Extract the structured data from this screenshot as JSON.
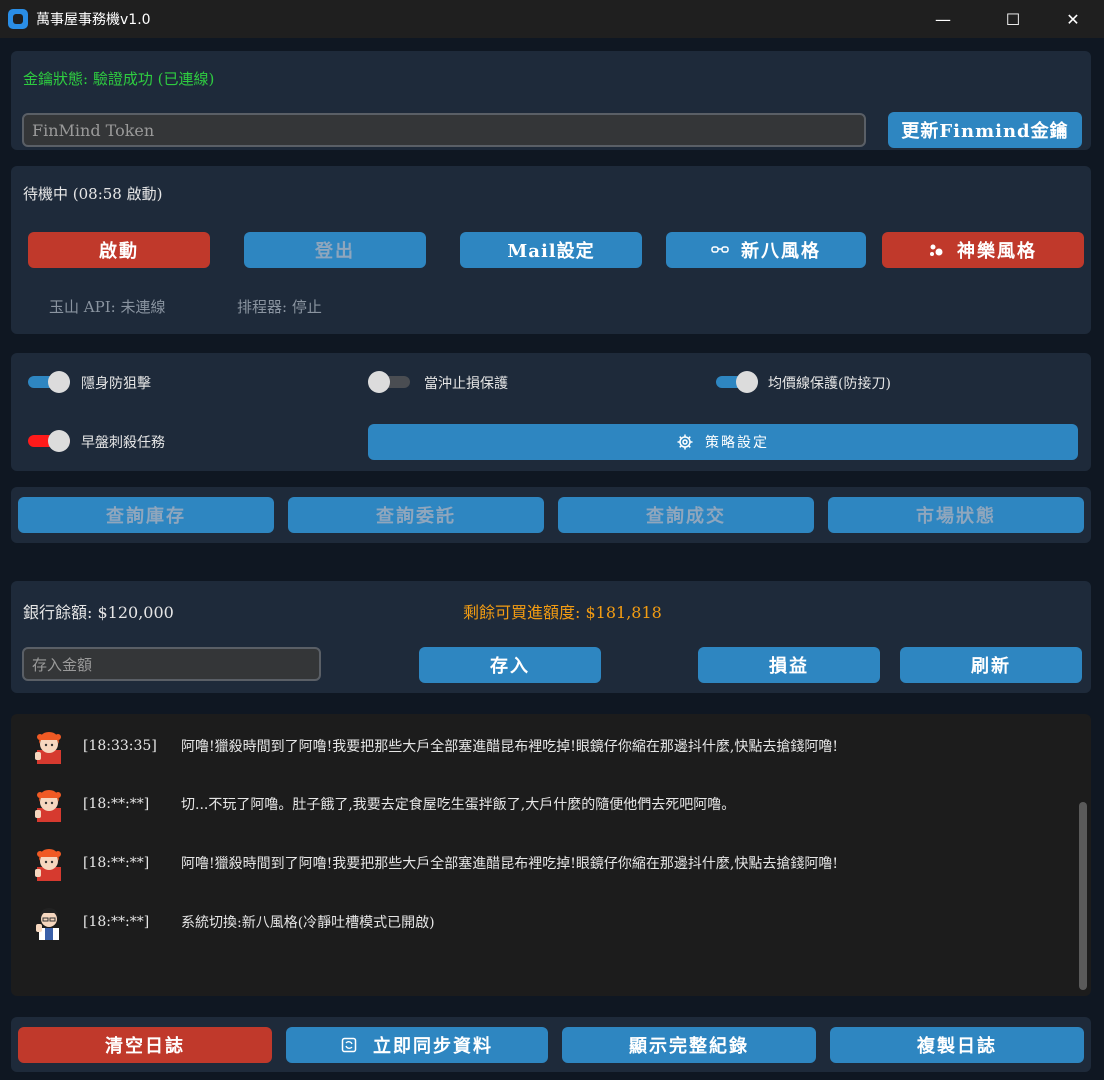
{
  "window": {
    "title": "萬事屋事務機v1.0",
    "minimize_glyph": "—",
    "maximize_glyph": "☐",
    "close_glyph": "✕"
  },
  "key_panel": {
    "status": "金鑰狀態: 驗證成功 (已連線)",
    "token_placeholder": "FinMind Token",
    "update_button": "更新Finmind金鑰"
  },
  "control_panel": {
    "status": "待機中 (08:58 啟動)",
    "buttons": {
      "start": "啟動",
      "logout": "登出",
      "mail": "Mail設定",
      "shinpachi": "新八風格",
      "kagura": "神樂風格"
    },
    "shinpachi_icon": "glasses-icon",
    "kagura_icon": "paw-icon",
    "api_status": "玉山 API: 未連線",
    "scheduler_status": "排程器: 停止"
  },
  "options_panel": {
    "toggles": [
      {
        "label": "隱身防狙擊",
        "state": "on"
      },
      {
        "label": "當沖止損保護",
        "state": "off"
      },
      {
        "label": "均價線保護(防接刀)",
        "state": "on"
      },
      {
        "label": "早盤刺殺任務",
        "state": "on-red"
      }
    ],
    "strategy_button": "策略設定",
    "strategy_icon": "gear-icon",
    "colors": {
      "on": "#2e86c1",
      "off": "#4a4d52",
      "danger": "#ff1a1a"
    }
  },
  "query_panel": {
    "inventory": "查詢庫存",
    "orders": "查詢委託",
    "deals": "查詢成交",
    "market": "市場狀態"
  },
  "bank_panel": {
    "balance": "銀行餘額: $120,000",
    "remaining": "剩餘可買進額度: $181,818",
    "deposit_placeholder": "存入金額",
    "deposit_button": "存入",
    "pnl_button": "損益",
    "refresh_button": "刷新",
    "remaining_color": "#f39c12"
  },
  "log": {
    "entries": [
      {
        "avatar": "kagura-avatar",
        "time": "[18:33:35]",
        "message": "阿噜!獵殺時間到了阿噜!我要把那些大戶全部塞進醋昆布裡吃掉!眼鏡仔你縮在那邊抖什麼,快點去搶錢阿噜!"
      },
      {
        "avatar": "kagura-avatar",
        "time": "[18:**:**]",
        "message": "切...不玩了阿噜。肚子餓了,我要去定食屋吃生蛋拌飯了,大戶什麼的隨便他們去死吧阿噜。"
      },
      {
        "avatar": "kagura-avatar",
        "time": "[18:**:**]",
        "message": "阿噜!獵殺時間到了阿噜!我要把那些大戶全部塞進醋昆布裡吃掉!眼鏡仔你縮在那邊抖什麼,快點去搶錢阿噜!"
      },
      {
        "avatar": "shinpachi-avatar",
        "time": "[18:**:**]",
        "message": "系統切換:新八風格(冷靜吐槽模式已開啟)"
      }
    ]
  },
  "bottom_bar": {
    "clear": "清空日誌",
    "sync": "立即同步資料",
    "sync_icon": "sync-icon",
    "show_all": "顯示完整紀錄",
    "copy": "複製日誌"
  }
}
